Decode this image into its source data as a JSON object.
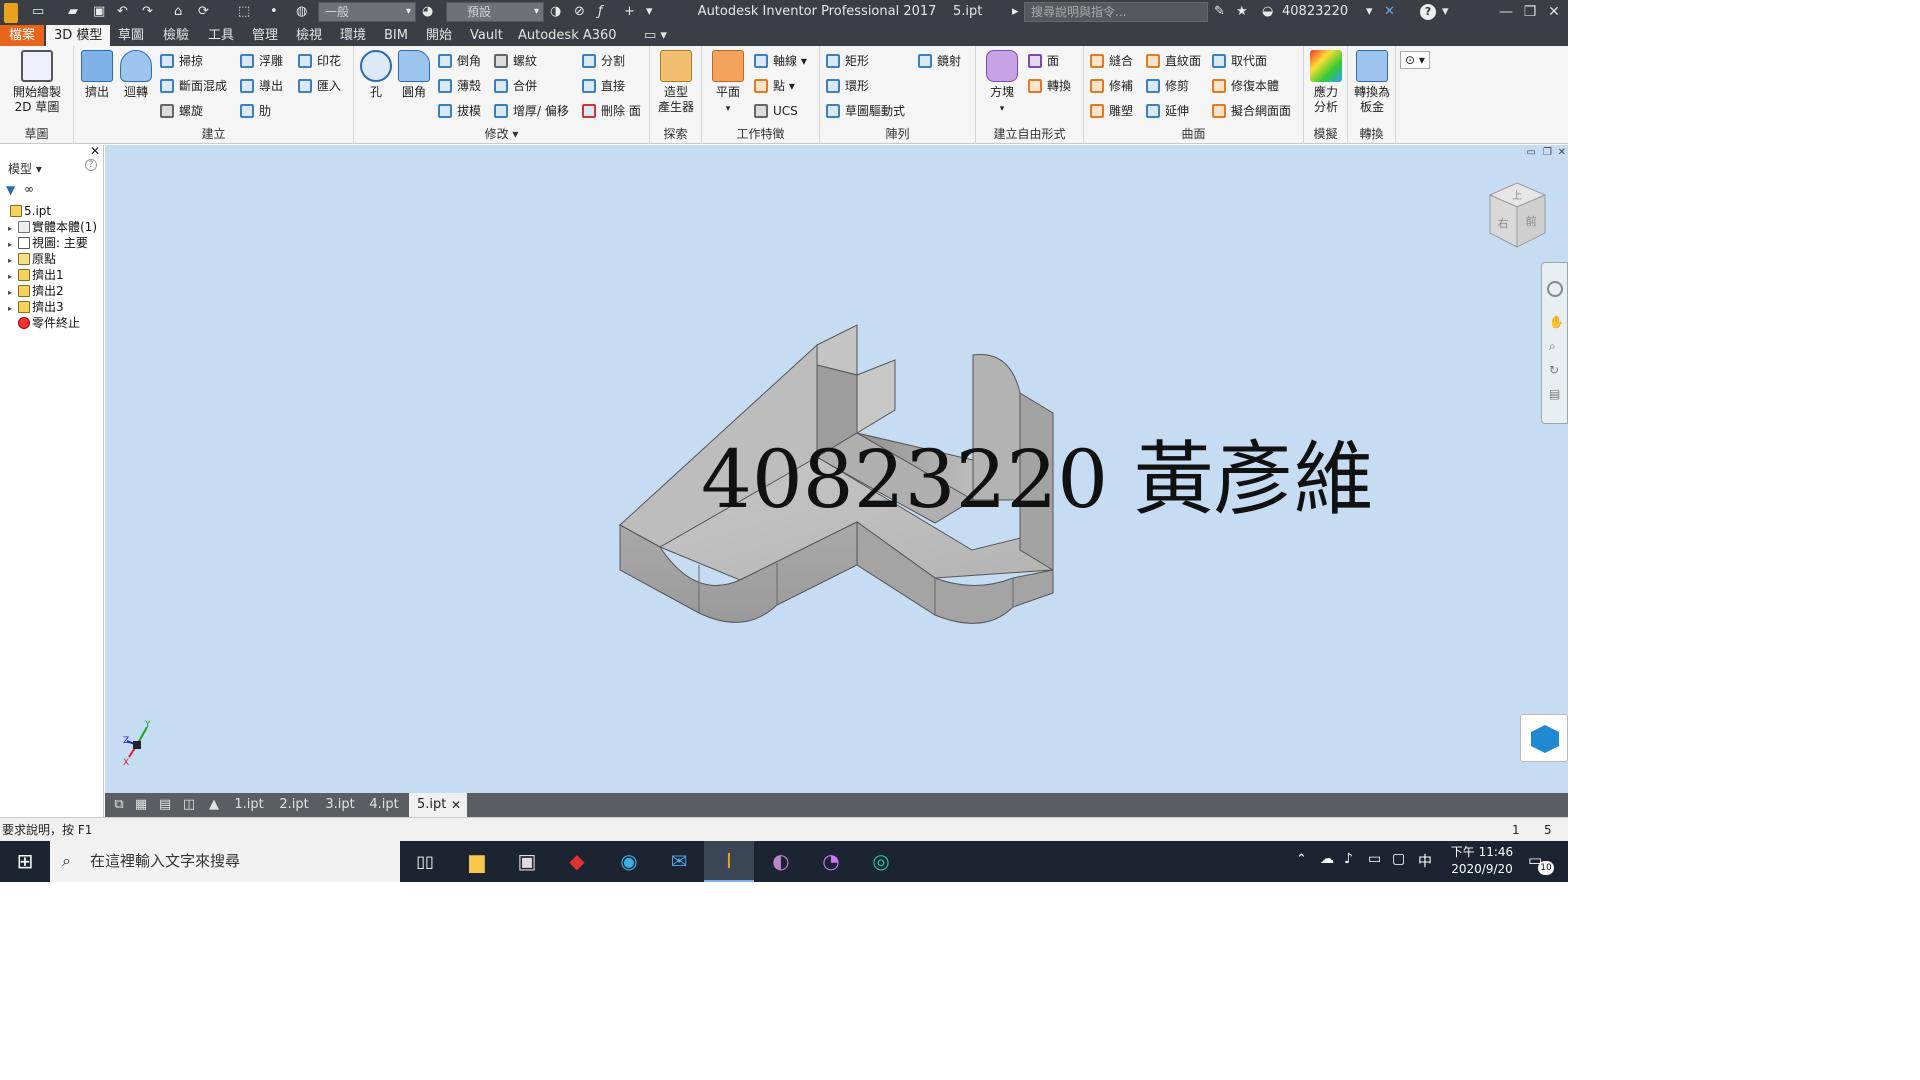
{
  "titlebar": {
    "style_combo": "一般",
    "appearance_combo": "預設",
    "app_title": "Autodesk Inventor Professional 2017",
    "doc_name": "5.ipt",
    "help_search_placeholder": "搜尋說明與指令...",
    "user_name": "40823220"
  },
  "menubar": {
    "tabs": [
      "檔案",
      "3D 模型",
      "草圖",
      "檢驗",
      "工具",
      "管理",
      "檢視",
      "環境",
      "BIM",
      "開始",
      "Vault",
      "Autodesk A360"
    ]
  },
  "ribbon": {
    "sketch": {
      "title": "草圖",
      "start_sketch_l1": "開始繪製",
      "start_sketch_l2": "2D 草圖"
    },
    "create": {
      "title": "建立",
      "extrude": "擠出",
      "revolve": "迴轉",
      "sweep": "掃掠",
      "loft": "斷面混成",
      "coil": "螺旋",
      "emboss": "浮雕",
      "derive": "導出",
      "rib": "肋",
      "decal": "印花",
      "import": "匯入"
    },
    "modify": {
      "title": "修改",
      "hole": "孔",
      "fillet": "圓角",
      "chamfer": "倒角",
      "shell": "薄殼",
      "draft": "拔模",
      "thread": "螺紋",
      "combine": "合併",
      "thicken": "增厚/ 偏移",
      "split": "分割",
      "direct": "直接",
      "delete_face": "刪除 面"
    },
    "explore": {
      "title": "探索",
      "shape_gen_l1": "造型",
      "shape_gen_l2": "產生器"
    },
    "work_features": {
      "title": "工作特徵",
      "plane": "平面",
      "axis": "軸線",
      "point": "點",
      "ucs": "UCS"
    },
    "pattern": {
      "title": "陣列",
      "rect": "矩形",
      "circ": "環形",
      "sketch_driven": "草圖驅動式",
      "mirror": "鏡射"
    },
    "freeform": {
      "title": "建立自由形式",
      "box": "方塊",
      "face": "面",
      "convert": "轉換"
    },
    "surface": {
      "title": "曲面",
      "stitch": "縫合",
      "patch": "修補",
      "sculpt": "雕塑",
      "ruled": "直紋面",
      "trim": "修剪",
      "extend": "延伸",
      "replace_face": "取代面",
      "repair": "修復本體",
      "fit_mesh": "擬合網面面"
    },
    "simulation": {
      "title": "模擬",
      "stress_l1": "應力",
      "stress_l2": "分析"
    },
    "convert": {
      "title": "轉換",
      "sheet_l1": "轉換為",
      "sheet_l2": "板金"
    }
  },
  "browser": {
    "header": "模型",
    "items": [
      "5.ipt",
      "實體本體(1)",
      "視圖: 主要",
      "原點",
      "擠出1",
      "擠出2",
      "擠出3",
      "零件終止"
    ]
  },
  "viewport": {
    "overlay_text": "40823220 黃彥維",
    "viewcube_top": "上",
    "viewcube_right": "右",
    "viewcube_front": "前",
    "axis_x": "X",
    "axis_y": "Y",
    "axis_z": "Z"
  },
  "doc_tabs": [
    "1.ipt",
    "2.ipt",
    "3.ipt",
    "4.ipt",
    "5.ipt"
  ],
  "status": {
    "help_text": "要求說明，按 F1",
    "count_a": "1",
    "count_b": "5"
  },
  "taskbar": {
    "search_placeholder": "在這裡輸入文字來搜尋",
    "ime": "中",
    "time": "下午 11:46",
    "date": "2020/9/20",
    "notification_count": "10"
  },
  "colors": {
    "accent": "#e8641b",
    "viewport": "#c5dcf3",
    "titlebar": "#3b3f45"
  }
}
